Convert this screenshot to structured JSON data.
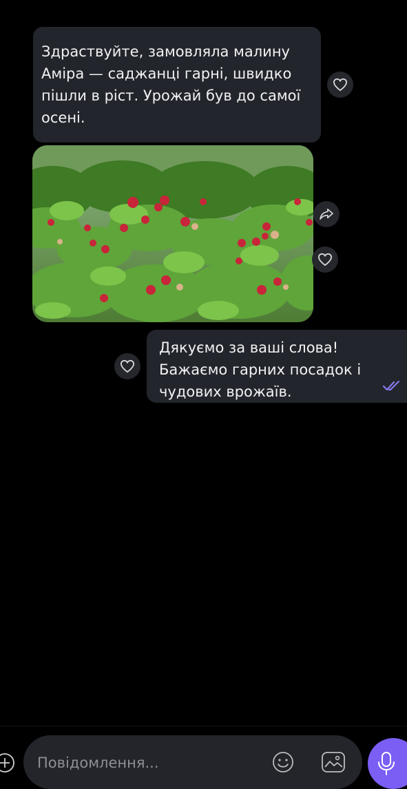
{
  "messages": {
    "incoming_text": "Здраствуйте, замовляла малину Аміра — саджанці гарні, швидко пішли в ріст. Урожай був до самої осені.",
    "outgoing_text": "Дякуємо за ваші слова! Бажаємо гарних посадок і чудових врожаїв.",
    "outgoing_status": "read"
  },
  "composer": {
    "placeholder": "Повідомлення..."
  },
  "icons": {
    "like": "heart-icon",
    "forward": "share-icon",
    "emoji": "smiley-icon",
    "sticker": "sticker-icon",
    "attach": "plus-icon",
    "voice": "microphone-icon"
  },
  "colors": {
    "background": "#000000",
    "bubble": "#23252d",
    "accent": "#7b5ef4",
    "read_ticks": "#8a7bf0"
  }
}
